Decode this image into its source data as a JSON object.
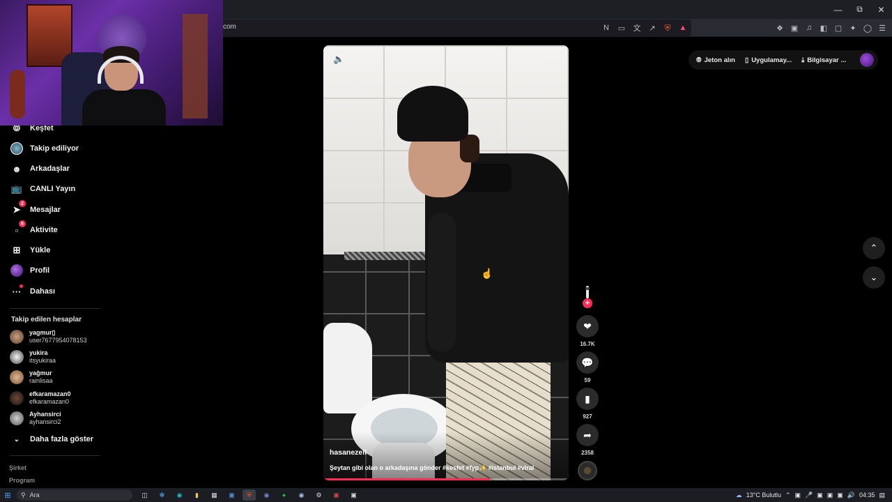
{
  "browser": {
    "url": "com",
    "window_controls": [
      "minimize",
      "maximize",
      "close"
    ]
  },
  "sidebar": {
    "nav": [
      {
        "label": "Keşfet",
        "icon": "compass-icon"
      },
      {
        "label": "Takip ediliyor",
        "icon": "following-avatar-icon"
      },
      {
        "label": "Arkadaşlar",
        "icon": "friends-icon"
      },
      {
        "label": "CANLI Yayın",
        "icon": "live-tv-icon"
      },
      {
        "label": "Mesajlar",
        "icon": "messages-icon",
        "badge": "2"
      },
      {
        "label": "Aktivite",
        "icon": "activity-icon",
        "badge": "5"
      },
      {
        "label": "Yükle",
        "icon": "upload-icon"
      },
      {
        "label": "Profil",
        "icon": "profile-avatar-icon"
      },
      {
        "label": "Dahası",
        "icon": "more-dots-icon"
      }
    ],
    "following_title": "Takip edilen hesaplar",
    "following": [
      {
        "name": "yagmur▯",
        "handle": "user7677954078153"
      },
      {
        "name": "yukira",
        "handle": "itsyukiraa"
      },
      {
        "name": "yağmur",
        "handle": "rainlisaa"
      },
      {
        "name": "efkaramazan0",
        "handle": "efkaramazan0"
      },
      {
        "name": "Ayhansirci",
        "handle": "ayhansirci2"
      }
    ],
    "show_more": "Daha fazla göster",
    "footer": [
      "Şirket",
      "Program"
    ]
  },
  "header": {
    "coins": "Jeton alın",
    "app": "Uygulamay...",
    "desktop": "Bilgisayar ..."
  },
  "video": {
    "author": "hasanezell",
    "description": "Şeytan gibi olan o arkadaşına gönder #kesfet #fyp✨ #istanbul #viral",
    "progress": 0.68
  },
  "actions": {
    "likes": "16.7K",
    "comments": "59",
    "saves": "927",
    "shares": "2358"
  },
  "taskbar": {
    "search_placeholder": "Ara",
    "weather": "13°C  Bulutlu",
    "time": "04:35"
  },
  "colors": {
    "accent": "#fe2c55",
    "background": "#000000"
  }
}
